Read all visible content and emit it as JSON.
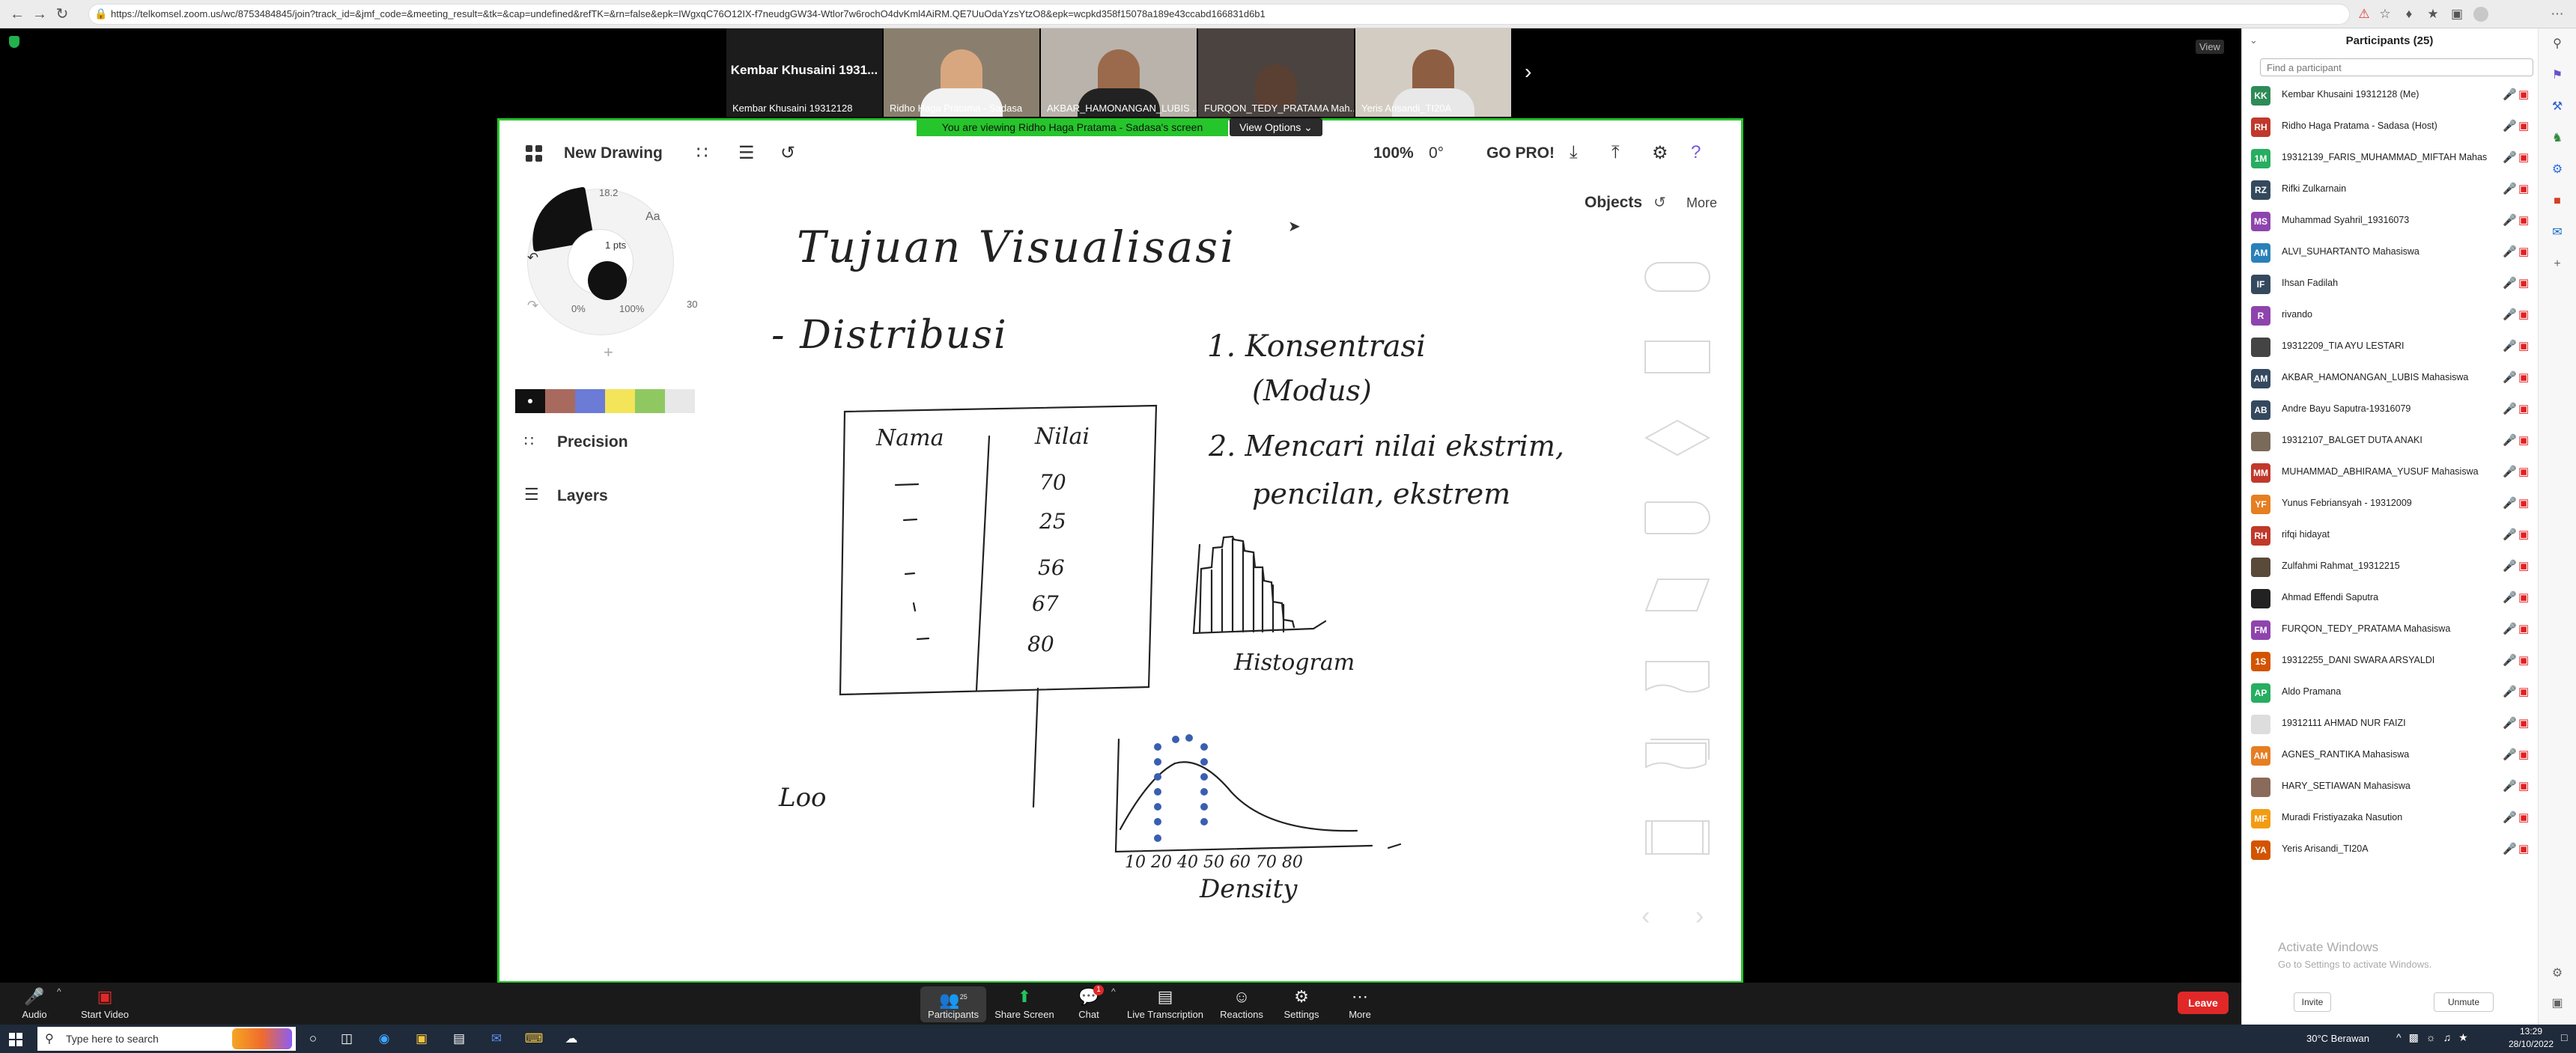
{
  "browser": {
    "url": "https://telkomsel.zoom.us/wc/8753484845/join?track_id=&jmf_code=&meeting_result=&tk=&cap=undefined&refTK=&rn=false&epk=IWgxqC76O12IX-f7neudgGW34-Wtlor7w6rochO4dvKml4AiRM.QE7UuOdaYzsYtzO8&epk=wcpkd358f15078a189e43ccabd166831d6b1"
  },
  "video_strip": {
    "tiles": [
      {
        "big": "Kembar Khusaini 1931...",
        "caption": "Kembar Khusaini 19312128"
      },
      {
        "caption": "Ridho Haga Pratama - Sadasa"
      },
      {
        "caption": "AKBAR_HAMONANGAN_LUBIS ..."
      },
      {
        "caption": "FURQON_TEDY_PRATAMA Mah..."
      },
      {
        "caption": "Yeris Arisandi_TI20A"
      }
    ],
    "view_label": "View"
  },
  "share": {
    "banner": "You are viewing Ridho Haga Pratama - Sadasa's screen",
    "view_options": "View Options"
  },
  "drawing_app": {
    "title": "New Drawing",
    "zoom": "100%",
    "rotation": "0°",
    "go_pro": "GO PRO!",
    "objects": "Objects",
    "more": "More",
    "precision": "Precision",
    "layers": "Layers",
    "wheel": {
      "size": "18.2",
      "pts": "1 pts",
      "opacity_min": "0%",
      "opacity_max": "100%",
      "text_tool": "Aa",
      "angle": "30"
    },
    "swatches": [
      "#111111",
      "#a86a5e",
      "#6b7bd6",
      "#f3e45a",
      "#8fc860",
      "#e8e8e8"
    ]
  },
  "handwriting": {
    "title": "Tujuan Visualisasi",
    "bullet": "- Distribusi",
    "table_headers": [
      "Nama",
      "Nilai"
    ],
    "table_values": [
      "70",
      "25",
      "56",
      "67",
      "80"
    ],
    "point1": "1. Konsentrasi",
    "point1b": "(Modus)",
    "point2": "2. Mencari nilai ekstrim,",
    "point2b": "pencilan, ekstrem",
    "histogram": "Histogram",
    "axis_ticks": "10 20 40 50 60 70 80",
    "density": "Density",
    "loo": "Loo"
  },
  "participants": {
    "title": "Participants (25)",
    "search_placeholder": "Find a participant",
    "list": [
      {
        "initials": "KK",
        "name": "Kembar Khusaini 19312128 (Me)",
        "color": "#2e8b57"
      },
      {
        "initials": "RH",
        "name": "Ridho Haga Pratama - Sadasa (Host)",
        "color": "#c0392b"
      },
      {
        "initials": "1M",
        "name": "19312139_FARIS_MUHAMMAD_MIFTAH Mahasi...",
        "color": "#27ae60"
      },
      {
        "initials": "RZ",
        "name": "Rifki Zulkarnain",
        "color": "#34495e"
      },
      {
        "initials": "MS",
        "name": "Muhammad Syahril_19316073",
        "color": "#8e44ad"
      },
      {
        "initials": "AM",
        "name": "ALVI_SUHARTANTO Mahasiswa",
        "color": "#2980b9"
      },
      {
        "initials": "IF",
        "name": "Ihsan Fadilah",
        "color": "#34495e"
      },
      {
        "initials": "R",
        "name": "rivando",
        "color": "#8e44ad"
      },
      {
        "initials": "",
        "name": "19312209_TIA AYU LESTARI",
        "color": "#444444"
      },
      {
        "initials": "AM",
        "name": "AKBAR_HAMONANGAN_LUBIS Mahasiswa",
        "color": "#34495e"
      },
      {
        "initials": "AB",
        "name": "Andre Bayu Saputra-19316079",
        "color": "#34495e"
      },
      {
        "initials": "",
        "name": "19312107_BALGET DUTA ANAKI",
        "color": "#7a6a5a"
      },
      {
        "initials": "MM",
        "name": "MUHAMMAD_ABHIRAMA_YUSUF Mahasiswa",
        "color": "#c0392b"
      },
      {
        "initials": "YF",
        "name": "Yunus Febriansyah - 19312009",
        "color": "#e67e22"
      },
      {
        "initials": "RH",
        "name": "rifqi hidayat",
        "color": "#c0392b"
      },
      {
        "initials": "",
        "name": "Zulfahmi Rahmat_19312215",
        "color": "#5a4a3a"
      },
      {
        "initials": "",
        "name": "Ahmad Effendi Saputra",
        "color": "#222222"
      },
      {
        "initials": "FM",
        "name": "FURQON_TEDY_PRATAMA Mahasiswa",
        "color": "#8e44ad"
      },
      {
        "initials": "1S",
        "name": "19312255_DANI SWARA ARSYALDI",
        "color": "#d35400"
      },
      {
        "initials": "AP",
        "name": "Aldo Pramana",
        "color": "#27ae60"
      },
      {
        "initials": "",
        "name": "19312111 AHMAD NUR FAIZI",
        "color": "#dddddd"
      },
      {
        "initials": "AM",
        "name": "AGNES_RANTIKA Mahasiswa",
        "color": "#e67e22"
      },
      {
        "initials": "",
        "name": "HARY_SETIAWAN Mahasiswa",
        "color": "#8a6a5a"
      },
      {
        "initials": "MF",
        "name": "Muradi Fristiyazaka Nasution",
        "color": "#f39c12"
      },
      {
        "initials": "YA",
        "name": "Yeris Arisandi_TI20A",
        "color": "#d35400"
      }
    ],
    "activate_title": "Activate Windows",
    "activate_sub": "Go to Settings to activate Windows.",
    "invite": "Invite",
    "unmute": "Unmute"
  },
  "controls": {
    "audio": "Audio",
    "start_video": "Start Video",
    "participants": "Participants",
    "participants_count": "25",
    "share_screen": "Share Screen",
    "chat": "Chat",
    "chat_badge": "1",
    "live_transcription": "Live Transcription",
    "reactions": "Reactions",
    "settings": "Settings",
    "more": "More",
    "leave": "Leave"
  },
  "taskbar": {
    "search_placeholder": "Type here to search",
    "weather": "30°C  Berawan",
    "time": "13:29",
    "date": "28/10/2022"
  }
}
